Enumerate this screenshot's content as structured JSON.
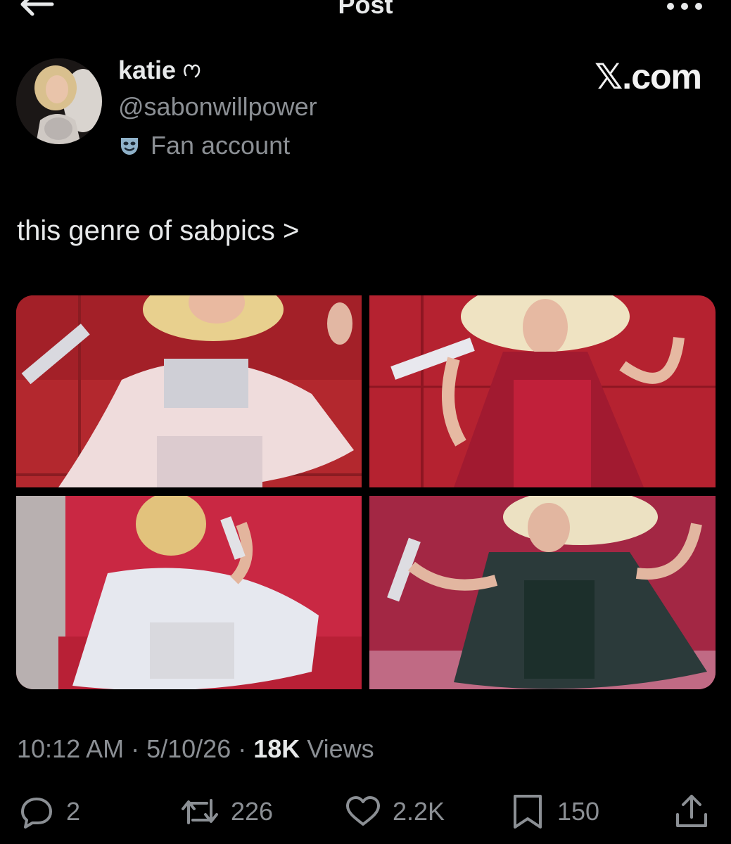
{
  "header": {
    "title": "Post"
  },
  "author": {
    "display_name": "katie",
    "handle": "@sabonwillpower",
    "label": "Fan account"
  },
  "watermark": "𝕏.com",
  "post": {
    "text": "this genre of sabpics >"
  },
  "meta": {
    "time": "10:12 AM",
    "date": "5/10/26",
    "views_count": "18K",
    "views_label": "Views",
    "sep1": " · ",
    "sep2": " · "
  },
  "actions": {
    "replies": "2",
    "reposts": "226",
    "likes": "2.2K",
    "bookmarks": "150"
  },
  "colors": {
    "background": "#000000",
    "text_primary": "#e7e9ea",
    "text_secondary": "#8b8f94"
  }
}
